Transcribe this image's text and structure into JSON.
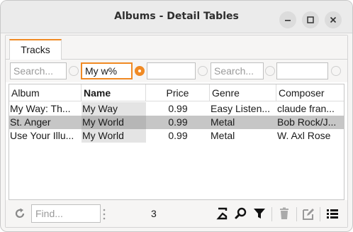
{
  "window": {
    "title": "Albums - Detail Tables",
    "minimize_icon": "minimize-icon",
    "maximize_icon": "maximize-icon",
    "close_icon": "close-icon"
  },
  "tabs": [
    {
      "label": "Tracks",
      "active": true
    }
  ],
  "filters": {
    "album": {
      "value": "",
      "placeholder": "Search..."
    },
    "name": {
      "value": "My w%",
      "placeholder": ""
    },
    "price": {
      "value": "",
      "placeholder": ""
    },
    "genre": {
      "value": "",
      "placeholder": "Search..."
    },
    "composer": {
      "value": "",
      "placeholder": ""
    }
  },
  "table": {
    "columns": [
      "Album",
      "Name",
      "Price",
      "Genre",
      "Composer"
    ],
    "rows": [
      {
        "album": "My Way: Th...",
        "name": "My Way",
        "price": "0.99",
        "genre": "Easy Listen...",
        "composer": "claude fran..."
      },
      {
        "album": "St. Anger",
        "name": "My World",
        "price": "0.99",
        "genre": "Metal",
        "composer": "Bob Rock/J..."
      },
      {
        "album": "Use Your Illu...",
        "name": "My World",
        "price": "0.99",
        "genre": "Metal",
        "composer": "W. Axl Rose"
      }
    ],
    "selected_row": 1
  },
  "bottombar": {
    "find_placeholder": "Find...",
    "row_count": "3",
    "icons": [
      "refresh-icon",
      "sum-icon",
      "search-icon",
      "filter-icon",
      "delete-icon",
      "edit-icon",
      "list-icon"
    ]
  },
  "colors": {
    "accent": "#f08a24",
    "selection": "#c6c6c6"
  }
}
